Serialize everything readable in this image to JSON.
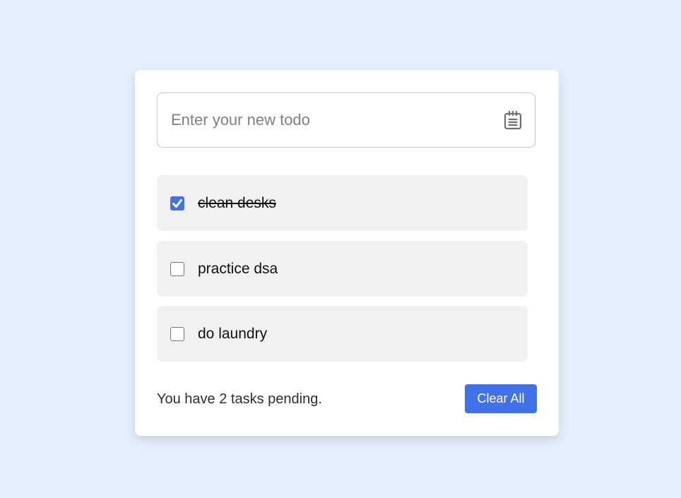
{
  "input": {
    "placeholder": "Enter your new todo",
    "value": "",
    "icon": "notepad-icon"
  },
  "todos": [
    {
      "text": "clean desks",
      "done": true
    },
    {
      "text": "practice dsa",
      "done": false
    },
    {
      "text": "do laundry",
      "done": false
    }
  ],
  "footer": {
    "status_text": "You have 2 tasks pending.",
    "pending_count": 2,
    "clear_label": "Clear All"
  },
  "colors": {
    "background": "#e3f0fb",
    "card": "#ffffff",
    "item_background": "#f1f1f1",
    "accent": "#4272e8"
  }
}
